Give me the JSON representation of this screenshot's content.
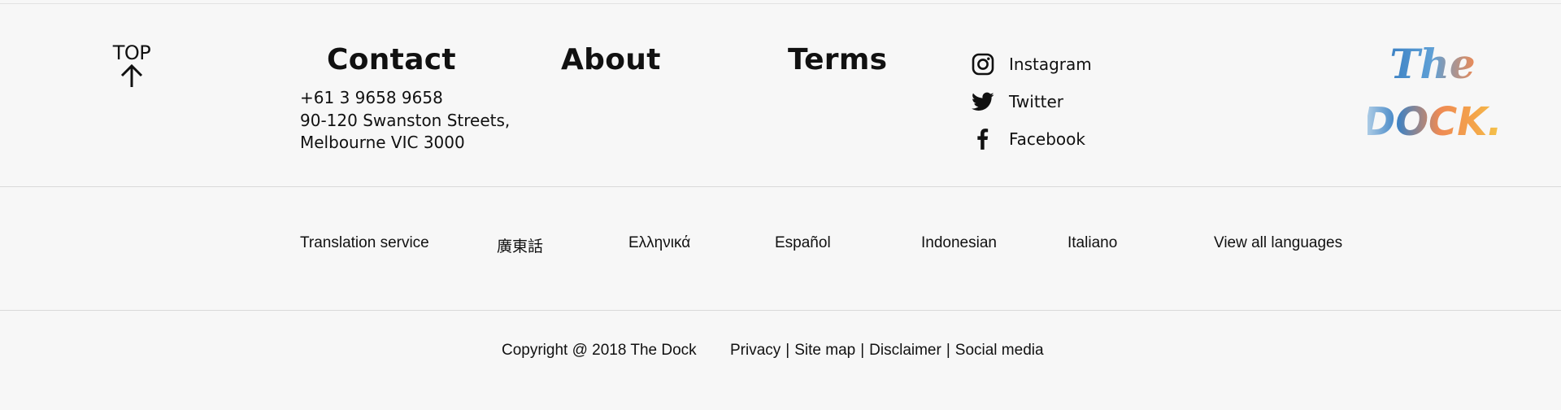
{
  "top_link": {
    "label": "TOP"
  },
  "nav": {
    "contact": "Contact",
    "about": "About",
    "terms": "Terms"
  },
  "contact": {
    "phone": "+61 3 9658 9658",
    "address_line1": "90-120 Swanston Streets,",
    "address_line2": "Melbourne VIC 3000"
  },
  "social": [
    {
      "label": "Instagram",
      "icon": "instagram-icon"
    },
    {
      "label": "Twitter",
      "icon": "twitter-icon"
    },
    {
      "label": "Facebook",
      "icon": "facebook-icon"
    }
  ],
  "logo": {
    "line1": "The",
    "line2": "DOCK."
  },
  "languages": [
    "Translation service",
    "廣東話",
    "Ελληνικά",
    "Español",
    "Indonesian",
    "Italiano",
    "View all languages"
  ],
  "footer": {
    "copyright": "Copyright @ 2018 The Dock",
    "links": [
      "Privacy",
      "Site map",
      "Disclaimer",
      "Social media"
    ],
    "separator": "|"
  },
  "colors": {
    "background": "#f7f7f7",
    "text": "#111111",
    "divider": "#d9d9d9",
    "logo_blue": "#3d82c4",
    "logo_orange": "#ee8a54",
    "logo_yellow": "#f4c64a"
  }
}
